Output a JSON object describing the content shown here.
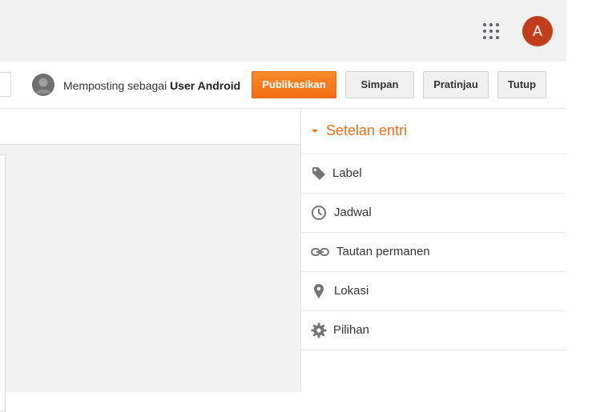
{
  "header": {
    "apps_icon": "apps-grid-icon",
    "account_initial": "A",
    "account_color": "#c13d1b"
  },
  "toolbar": {
    "posting_as_prefix": "Memposting sebagai",
    "user_name": "User Android",
    "publish_label": "Publikasikan",
    "save_label": "Simpan",
    "preview_label": "Pratinjau",
    "close_label": "Tutup",
    "accent_color": "#f36f13"
  },
  "sidebar": {
    "title": "Setelan entri",
    "items": [
      {
        "label": "Label",
        "icon": "tag-icon"
      },
      {
        "label": "Jadwal",
        "icon": "clock-icon"
      },
      {
        "label": "Tautan permanen",
        "icon": "link-icon"
      },
      {
        "label": "Lokasi",
        "icon": "location-pin-icon"
      },
      {
        "label": "Pilihan",
        "icon": "gear-icon"
      }
    ]
  }
}
